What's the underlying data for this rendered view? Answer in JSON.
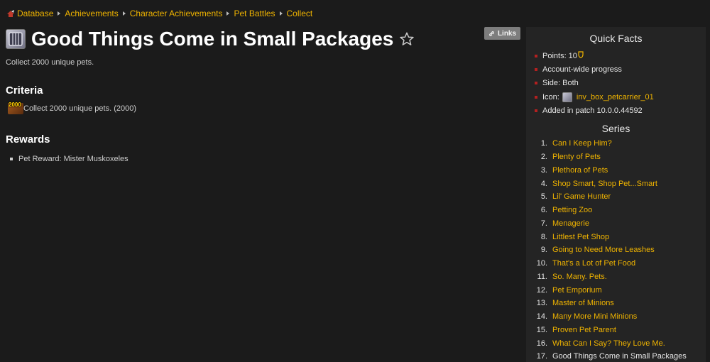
{
  "breadcrumb": [
    "Database",
    "Achievements",
    "Character Achievements",
    "Pet Battles",
    "Collect"
  ],
  "title": "Good Things Come in Small Packages",
  "links_label": "Links",
  "description": "Collect 2000 unique pets.",
  "criteria": {
    "heading": "Criteria",
    "badge": "2000",
    "text": "Collect 2000 unique pets. (2000)"
  },
  "rewards": {
    "heading": "Rewards",
    "items": [
      "Pet Reward: Mister Muskoxeles"
    ]
  },
  "quick_facts": {
    "title": "Quick Facts",
    "points": "Points: 10",
    "account_wide": "Account-wide progress",
    "side": "Side: Both",
    "icon_label": "Icon:",
    "icon_name": "inv_box_petcarrier_01",
    "patch": "Added in patch 10.0.0.44592"
  },
  "series": {
    "title": "Series",
    "items": [
      {
        "num": "1.",
        "label": "Can I Keep Him?"
      },
      {
        "num": "2.",
        "label": "Plenty of Pets"
      },
      {
        "num": "3.",
        "label": "Plethora of Pets"
      },
      {
        "num": "4.",
        "label": "Shop Smart, Shop Pet...Smart"
      },
      {
        "num": "5.",
        "label": "Lil' Game Hunter"
      },
      {
        "num": "6.",
        "label": "Petting Zoo"
      },
      {
        "num": "7.",
        "label": "Menagerie"
      },
      {
        "num": "8.",
        "label": "Littlest Pet Shop"
      },
      {
        "num": "9.",
        "label": "Going to Need More Leashes"
      },
      {
        "num": "10.",
        "label": "That's a Lot of Pet Food"
      },
      {
        "num": "11.",
        "label": "So. Many. Pets."
      },
      {
        "num": "12.",
        "label": "Pet Emporium"
      },
      {
        "num": "13.",
        "label": "Master of Minions"
      },
      {
        "num": "14.",
        "label": "Many More Mini Minions"
      },
      {
        "num": "15.",
        "label": "Proven Pet Parent"
      },
      {
        "num": "16.",
        "label": "What Can I Say? They Love Me."
      },
      {
        "num": "17.",
        "label": "Good Things Come in Small Packages"
      }
    ]
  },
  "colors": {
    "background": "#1b1b1b",
    "sidebar": "#242424",
    "link": "#f0b400",
    "bullet_red": "#b32020"
  },
  "icons": {
    "home": "home-icon",
    "title": "achievement-icon",
    "favorite": "star-icon",
    "links": "link-icon",
    "points": "shield-icon"
  }
}
